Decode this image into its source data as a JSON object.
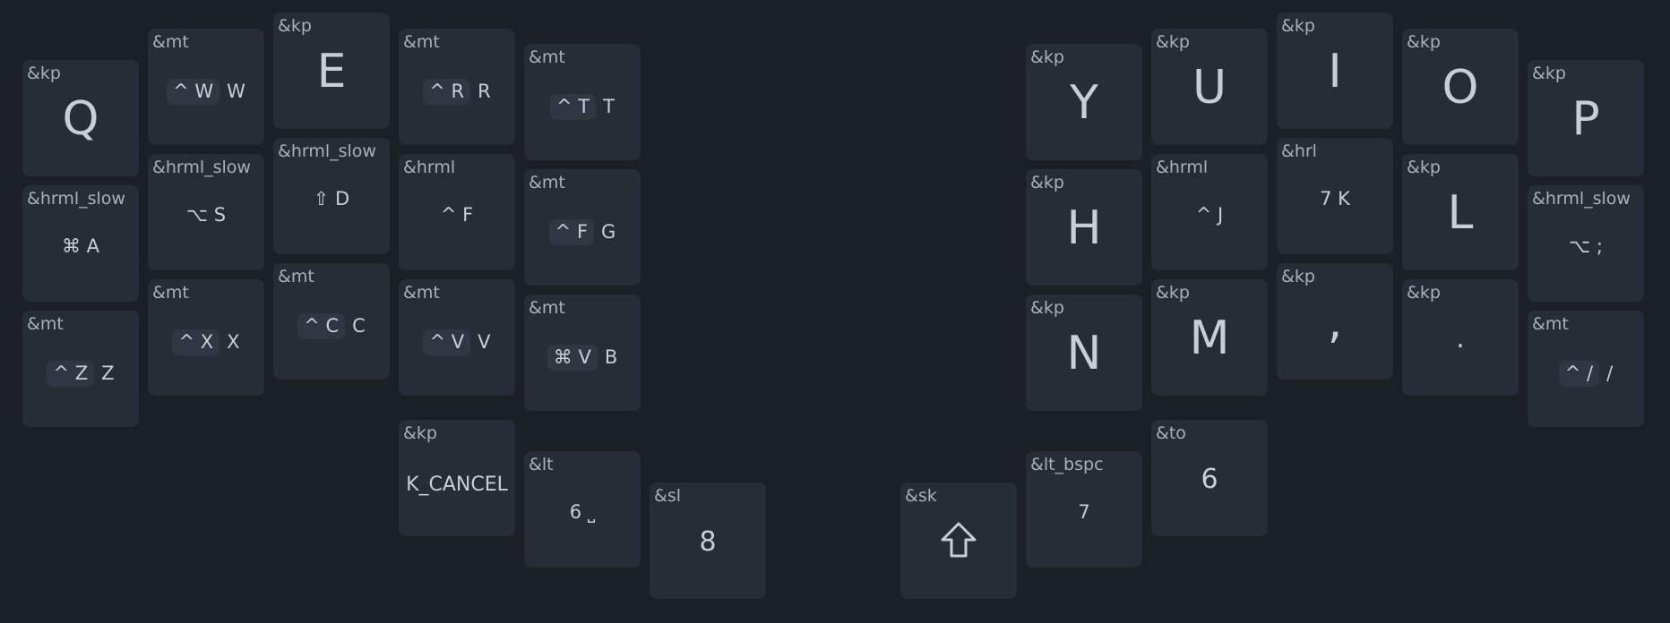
{
  "keys": {
    "q": {
      "behavior": "&kp",
      "label": "Q"
    },
    "w": {
      "behavior": "&mt",
      "mod": "^ W",
      "tap": "W"
    },
    "e": {
      "behavior": "&kp",
      "label": "E"
    },
    "r": {
      "behavior": "&mt",
      "mod": "^ R",
      "tap": "R"
    },
    "t": {
      "behavior": "&mt",
      "mod": "^ T",
      "tap": "T"
    },
    "a": {
      "behavior": "&hrml_slow",
      "label": "⌘ A"
    },
    "s": {
      "behavior": "&hrml_slow",
      "label": "⌥ S"
    },
    "d": {
      "behavior": "&hrml_slow",
      "label": "⇧ D"
    },
    "f": {
      "behavior": "&hrml",
      "label": "^ F"
    },
    "g": {
      "behavior": "&mt",
      "mod": "^ F",
      "tap": "G"
    },
    "z": {
      "behavior": "&mt",
      "mod": "^ Z",
      "tap": "Z"
    },
    "x": {
      "behavior": "&mt",
      "mod": "^ X",
      "tap": "X"
    },
    "c": {
      "behavior": "&mt",
      "mod": "^ C",
      "tap": "C"
    },
    "v": {
      "behavior": "&mt",
      "mod": "^ V",
      "tap": "V"
    },
    "b": {
      "behavior": "&mt",
      "mod": "⌘ V",
      "tap": "B"
    },
    "cancel": {
      "behavior": "&kp",
      "label": "K_CANCEL"
    },
    "lt_space": {
      "behavior": "&lt",
      "label": "6 ⎵"
    },
    "sl": {
      "behavior": "&sl",
      "label": "8"
    },
    "y": {
      "behavior": "&kp",
      "label": "Y"
    },
    "u": {
      "behavior": "&kp",
      "label": "U"
    },
    "i": {
      "behavior": "&kp",
      "label": "I"
    },
    "o": {
      "behavior": "&kp",
      "label": "O"
    },
    "p": {
      "behavior": "&kp",
      "label": "P"
    },
    "h": {
      "behavior": "&kp",
      "label": "H"
    },
    "j": {
      "behavior": "&hrml",
      "label": "^ J"
    },
    "k": {
      "behavior": "&hrl",
      "label": "7 K"
    },
    "l": {
      "behavior": "&kp",
      "label": "L"
    },
    "semi": {
      "behavior": "&hrml_slow",
      "label": "⌥ ;"
    },
    "n": {
      "behavior": "&kp",
      "label": "N"
    },
    "m": {
      "behavior": "&kp",
      "label": "M"
    },
    "comma": {
      "behavior": "&kp",
      "label": ","
    },
    "dot": {
      "behavior": "&kp",
      "label": "."
    },
    "slash": {
      "behavior": "&mt",
      "mod": "^ /",
      "tap": "/"
    },
    "sk": {
      "behavior": "&sk",
      "icon": "shift-arrow-icon"
    },
    "lt_bspc": {
      "behavior": "&lt_bspc",
      "label": "7"
    },
    "to": {
      "behavior": "&to",
      "label": "6"
    }
  }
}
